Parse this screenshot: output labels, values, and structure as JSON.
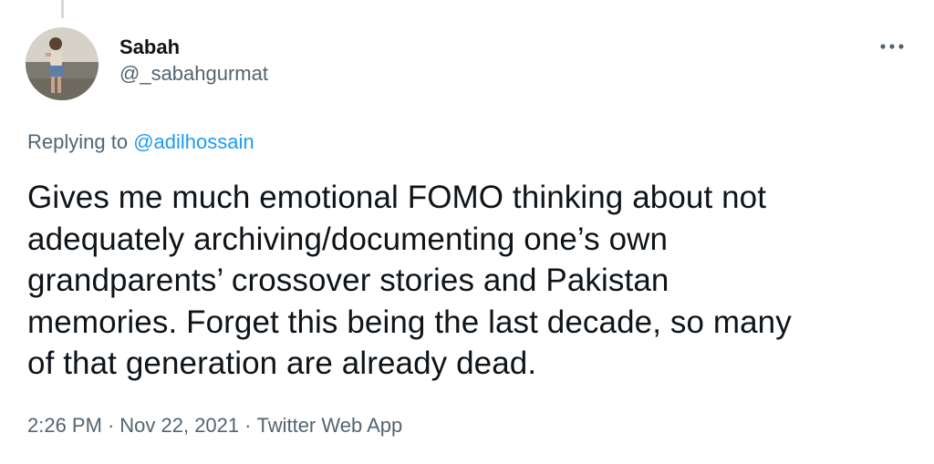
{
  "author": {
    "display_name": "Sabah",
    "handle": "@_sabahgurmat",
    "avatar_icon": "user-avatar-photo"
  },
  "more_icon": "ellipsis-horizontal-icon",
  "reply": {
    "prefix": "Replying to",
    "to_handle": "@adilhossain"
  },
  "tweet": {
    "lines": [
      "Gives me much emotional FOMO thinking about not",
      "adequately archiving/documenting one’s own",
      "grandparents’ crossover stories and Pakistan",
      "memories. Forget this being the last decade, so many",
      "of that generation are already dead."
    ]
  },
  "meta": {
    "time": "2:26 PM",
    "separator": "·",
    "date": "Nov 22, 2021",
    "source": "Twitter Web App"
  },
  "colors": {
    "primary_text": "#0f1419",
    "secondary_text": "#536471",
    "link": "#1d9bf0",
    "thread_line": "#cfd9de"
  }
}
